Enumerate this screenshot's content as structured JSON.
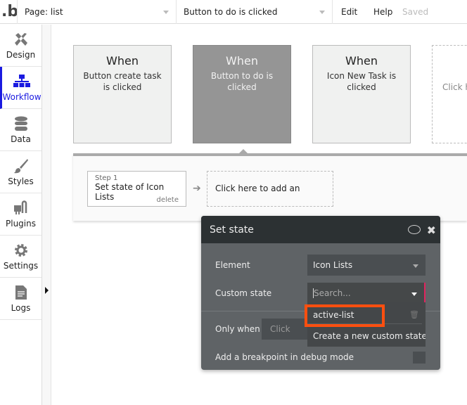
{
  "topbar": {
    "logo": ".b",
    "page_select": "Page: list",
    "event_select": "Button to do is clicked",
    "edit": "Edit",
    "help": "Help",
    "status": "Saved"
  },
  "sidebar": {
    "items": [
      {
        "label": "Design",
        "icon": "design-icon"
      },
      {
        "label": "Workflow",
        "icon": "workflow-icon",
        "active": true
      },
      {
        "label": "Data",
        "icon": "database-icon"
      },
      {
        "label": "Styles",
        "icon": "brush-icon"
      },
      {
        "label": "Plugins",
        "icon": "plug-icon"
      },
      {
        "label": "Settings",
        "icon": "gear-icon"
      },
      {
        "label": "Logs",
        "icon": "document-icon"
      }
    ]
  },
  "events": [
    {
      "when": "When",
      "text": "Button create task is clicked"
    },
    {
      "when": "When",
      "text": "Button to do is clicked",
      "selected": true
    },
    {
      "when": "When",
      "text": "Icon New Task is clicked"
    },
    {
      "text": "Click h"
    }
  ],
  "actions": {
    "step_label": "Step 1",
    "step_title": "Set state of Icon Lists",
    "delete": "delete",
    "add": "Click here to add an action..."
  },
  "panel": {
    "title": "Set state",
    "element_label": "Element",
    "element_value": "Icon Lists",
    "custom_state_label": "Custom state",
    "custom_state_placeholder": "Search...",
    "only_when_label": "Only when",
    "only_when_placeholder": "Click",
    "breakpoint_label": "Add a breakpoint in debug mode",
    "dropdown": {
      "options": [
        "active-list"
      ],
      "create": "Create a new custom state..."
    }
  },
  "colors": {
    "accent": "#1a1ae0",
    "highlight": "#ff4f0f",
    "invalid": "#e0245e"
  }
}
